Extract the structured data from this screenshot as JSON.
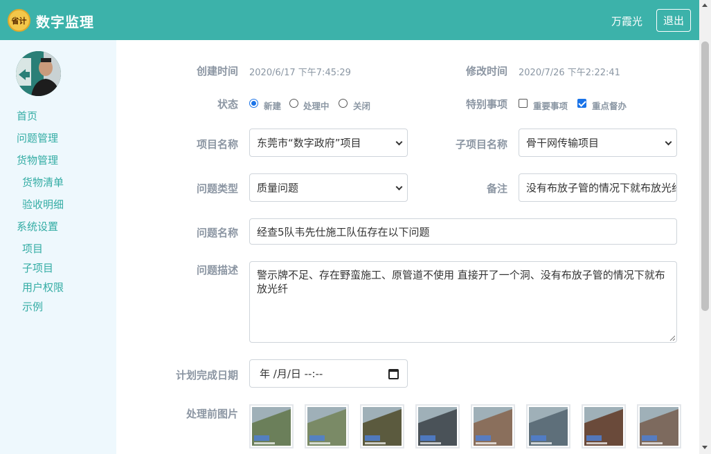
{
  "header": {
    "logo_text": "省计",
    "app_title": "数字监理",
    "user_name": "万霞光",
    "logout_label": "退出"
  },
  "sidebar": {
    "items": [
      {
        "label": "首页"
      },
      {
        "label": "问题管理"
      },
      {
        "label": "货物管理"
      },
      {
        "label": "货物清单"
      },
      {
        "label": "验收明细"
      },
      {
        "label": "系统设置"
      },
      {
        "label": "项目"
      },
      {
        "label": "子项目"
      },
      {
        "label": "用户权限"
      },
      {
        "label": "示例"
      }
    ]
  },
  "form": {
    "created_label": "创建时间",
    "created_value": "2020/6/17 下午7:45:29",
    "modified_label": "修改时间",
    "modified_value": "2020/7/26 下午2:22:41",
    "status_label": "状态",
    "status_options": [
      {
        "label": "新建",
        "checked": true
      },
      {
        "label": "处理中",
        "checked": false
      },
      {
        "label": "关闭",
        "checked": false
      }
    ],
    "special_label": "特别事项",
    "special_options": [
      {
        "label": "重要事项",
        "checked": false
      },
      {
        "label": "重点督办",
        "checked": true
      }
    ],
    "project_label": "项目名称",
    "project_value": "东莞市“数字政府”项目",
    "subproject_label": "子项目名称",
    "subproject_value": "骨干网传输项目",
    "type_label": "问题类型",
    "type_value": "质量问题",
    "remark_label": "备注",
    "remark_value": "没有布放子管的情况下就布放光纤",
    "name_label": "问题名称",
    "name_value": "经查5队韦先仕施工队伍存在以下问题",
    "desc_label": "问题描述",
    "desc_value": "警示牌不足、存在野蛮施工、原管道不使用 直接开了一个洞、没有布放子管的情况下就布放光纤",
    "due_label": "计划完成日期",
    "due_value": "年 /月/日 --:--",
    "photos_label": "处理前图片",
    "photos": [
      {
        "tone": "#6b7f5a"
      },
      {
        "tone": "#7a8a66"
      },
      {
        "tone": "#5b5a3e"
      },
      {
        "tone": "#4a5258"
      },
      {
        "tone": "#8a6f5c"
      },
      {
        "tone": "#5e6f7a"
      },
      {
        "tone": "#6a4a3a"
      },
      {
        "tone": "#7d6a5e"
      }
    ]
  },
  "colors": {
    "header_bg": "#3cb2aa",
    "nav_text": "#33aca4",
    "sidebar_bg": "#eef8fd",
    "label_text": "#8c96a3"
  }
}
